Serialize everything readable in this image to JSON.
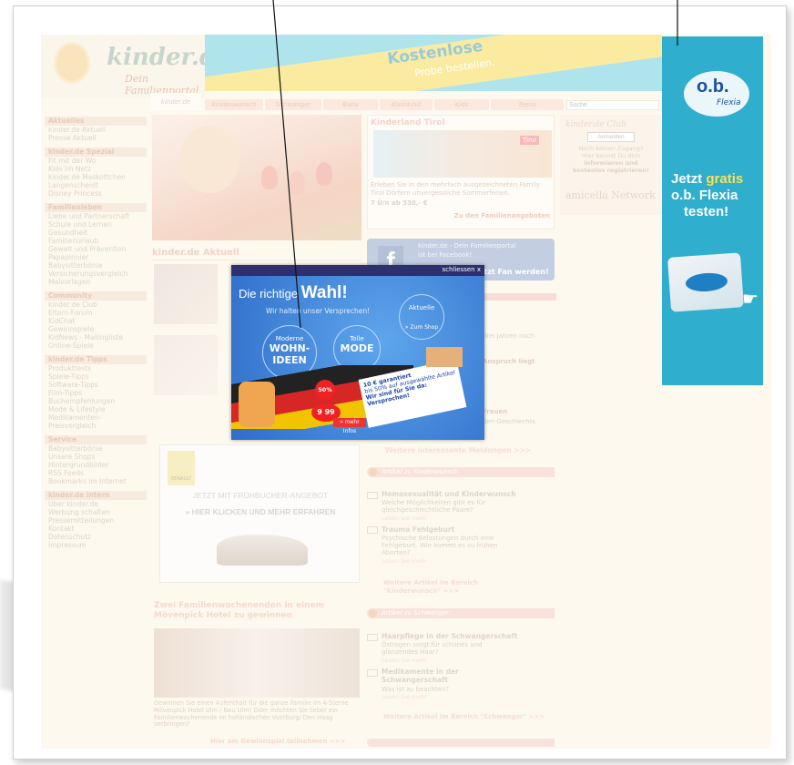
{
  "header": {
    "logo_text": "kinder.de",
    "logo_sub": "Dein Familienportal",
    "banner": "Kostenlose",
    "banner_sub": "Probe bestellen."
  },
  "tabs": [
    "kinder.de",
    "Kinderwunsch",
    "Schwanger",
    "Baby",
    "Kleinkind",
    "Kids",
    "Teens"
  ],
  "search": {
    "placeholder": "Suche"
  },
  "sidebar": [
    {
      "head": "Aktuelles",
      "items": [
        "kinder.de Aktuell",
        "Presse Aktuell"
      ]
    },
    {
      "head": "kinder.de Spezial",
      "items": [
        "Fit mit der Wo",
        "Kids im Netz",
        "kinder.de Maskottchen",
        "Langenscheidt",
        "Disney Princess"
      ]
    },
    {
      "head": "Familienleben",
      "items": [
        "Liebe und Partnerschaft",
        "Schule und Lernen",
        "Gesundheit",
        "Familienurlaub",
        "Gewalt und Prävention",
        "Papapinnier",
        "Babysitterbörse",
        "Versicherungsvergleich",
        "Malvorlagen"
      ]
    },
    {
      "head": "Community",
      "items": [
        "kinder.de Club",
        "Eltern-Forum",
        "KidChat",
        "Gewinnspiele",
        "KidNews - Mailingliste",
        "Online-Spiele"
      ]
    },
    {
      "head": "kinder.de Tipps",
      "items": [
        "Produkttests",
        "Spiele-Tipps",
        "Software-Tipps",
        "Film-Tipps",
        "Buchempfehlungen",
        "Mode & Lifestyle",
        "Medikamenten-",
        "Preisvergleich"
      ]
    },
    {
      "head": "Service",
      "items": [
        "Babysitterbörse",
        "Unsere Shops",
        "Hintergrundbilder",
        "RSS Feeds",
        "Bookmarks im Internet"
      ]
    },
    {
      "head": "kinder.de intern",
      "items": [
        "Über kinder.de",
        "Werbung schalten",
        "Pressemitteilungen",
        "Kontakt",
        "Datenschutz",
        "Impressum"
      ]
    }
  ],
  "tirol": {
    "title": "Kinderland Tirol",
    "text": "Erleben Sie in den mehrfach ausgezeichneten Family Tirol Dörfern unvergessliche Sommerferien.",
    "price": "7 Ü/n ab 330,- €",
    "link": "Zu den Familienangeboten",
    "badge": "Tirol"
  },
  "club": {
    "title": "kinder.de Club",
    "button": "Anmelden",
    "line1": "Noch keinen Zugang?",
    "line2": "Hier kannst Du dich",
    "line3": "informieren und",
    "line4": "kostenlos registrieren!",
    "partner": "amicella Network"
  },
  "facebook": {
    "line1": "kinder.de - Dein Familienportal",
    "line2": "ist bei Facebook!",
    "fan": "Jetzt Fan werden!"
  },
  "aktuell_title": "kinder.de Aktuell",
  "snippets": [
    "drei Jahren noch",
    "Anspruch liegt",
    "Frauen",
    "den Geschlechts"
  ],
  "weitere": "Weitere interessante Meldungen >>>",
  "sec_kinderwunsch": "Artikel zu Kinderwunsch",
  "art1": {
    "title": "Homosexualität und Kinderwunsch",
    "text": "Welche Möglichkeiten gibt es für gleichgeschlechtliche Paare?",
    "more": "Lesen Sie mehr"
  },
  "art2": {
    "title": "Trauma Fehlgeburt",
    "text": "Psychische Belastungen durch eine Fehlgeburt. Wie kommt es zu frühen Aborten?",
    "more": "Lesen Sie mehr"
  },
  "weitere_kw": "Weitere Artikel im Bereich \"Kinderwunsch\" >>>",
  "sec_schwanger": "Artikel zu Schwanger",
  "art3": {
    "title": "Haarpflege in der Schwangerschaft",
    "text": "Östrogen sorgt für schönes und glänzendes Haar?",
    "more": "Lesen Sie mehr"
  },
  "art4": {
    "title": "Medikamente in der Schwangerschaft",
    "text": "Was ist zu beachten?",
    "more": "Lesen Sie mehr"
  },
  "weitere_sw": "Weitere Artikel im Bereich \"Schwanger\" >>>",
  "renault": {
    "brand": "RENAULT",
    "line1": "JETZT MIT FRÜHBUCHER-ANGEBOT",
    "line2": "» HIER KLICKEN UND MEHR ERFAHREN"
  },
  "moevenpick": {
    "title": "Zwei Familienwochenenden in einem Mövenpick Hotel zu gewinnen",
    "text": "Gewinnen Sie einen Aufenthalt für die ganze Familie im 4-Sterne Mövenpick Hotel Ulm / Neu Ulm! Oder möchten Sie lieber ein Familienwochenende im holländischen Voorburg/ Den Haag verbringen?",
    "link": "Hier am Gewinnspiel teilnehmen >>>"
  },
  "popup": {
    "close": "schliessen  x",
    "headline_a": "Die richtige",
    "headline_b": "Wahl!",
    "sub": "Wir halten unser Versprechen!",
    "c1a": "Moderne",
    "c1b": "WOHN-",
    "c1c": "IDEEN",
    "c2a": "Tolle",
    "c2b": "MODE",
    "c3": "Aktuelle",
    "shop": "» Zum Shop",
    "pct": "50%",
    "price": "9 99",
    "badge1": "10 € garantiert",
    "badge2": "bis 50% auf ausgewählte Artikel",
    "badge3": "Wir sind für Sie da: Versprochen!",
    "more": "» mehr Infos"
  },
  "ob": {
    "brand": "o.b.",
    "flexia": "Flexia",
    "pitch1": "Jetzt",
    "pitch_gratis": "gratis",
    "pitch2": "o.b. Flexia",
    "pitch3": "testen!"
  }
}
